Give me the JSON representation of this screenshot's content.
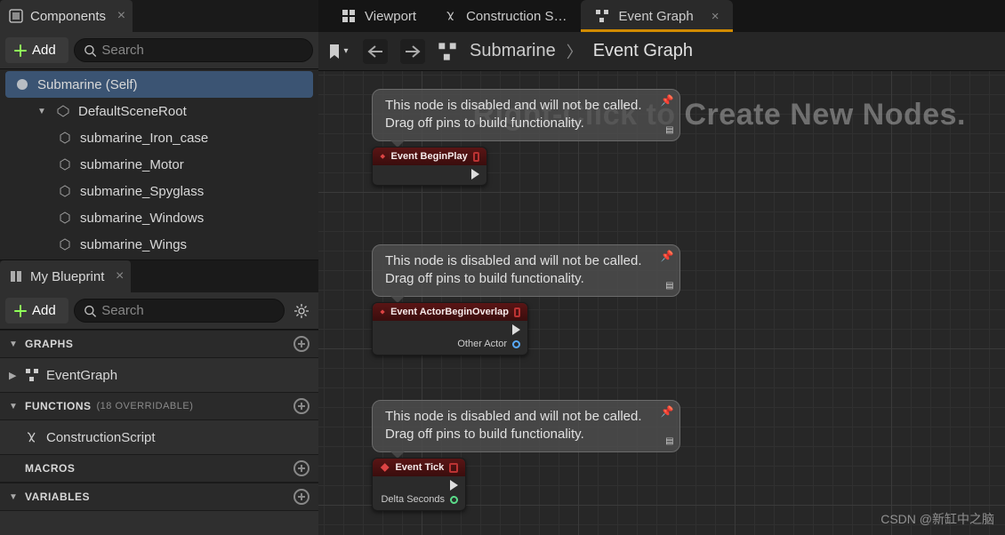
{
  "components": {
    "tab_label": "Components",
    "add_label": "Add",
    "search_placeholder": "Search",
    "tree": {
      "root": "Submarine (Self)",
      "scene_root": "DefaultSceneRoot",
      "children": [
        "submarine_Iron_case",
        "submarine_Motor",
        "submarine_Spyglass",
        "submarine_Windows",
        "submarine_Wings"
      ]
    }
  },
  "my_blueprint": {
    "tab_label": "My Blueprint",
    "add_label": "Add",
    "search_placeholder": "Search",
    "sections": {
      "graphs": {
        "title": "GRAPHS",
        "item": "EventGraph"
      },
      "functions": {
        "title": "FUNCTIONS",
        "sub": "(18 OVERRIDABLE)",
        "item": "ConstructionScript"
      },
      "macros": {
        "title": "MACROS"
      },
      "variables": {
        "title": "VARIABLES"
      }
    }
  },
  "top_tabs": {
    "viewport": "Viewport",
    "construction": "Construction S…",
    "event_graph": "Event Graph"
  },
  "breadcrumb": {
    "root": "Submarine",
    "leaf": "Event Graph"
  },
  "hint": "Right-Click to Create New Nodes.",
  "tooltip": {
    "line1": "This node is disabled and will not be called.",
    "line2": "Drag off pins to build functionality."
  },
  "nodes": {
    "begin_play": "Event BeginPlay",
    "actor_overlap": "Event ActorBeginOverlap",
    "overlap_out": "Other Actor",
    "tick": "Event Tick",
    "tick_out": "Delta Seconds"
  },
  "watermark": "CSDN @新缸中之脑"
}
